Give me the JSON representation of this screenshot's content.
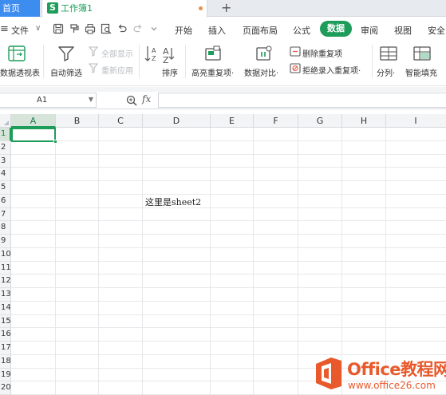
{
  "tabs": {
    "home": "首页",
    "workbook": "工作簿1",
    "workbook_icon": "S",
    "add": "+"
  },
  "menu": {
    "toggle": "≡",
    "file": "文件",
    "file_arrow": "∨",
    "tabs": [
      "开始",
      "插入",
      "页面布局",
      "公式",
      "数据",
      "审阅",
      "视图",
      "安全"
    ],
    "active_tab": "数据"
  },
  "ribbon": {
    "pivot": "数据透视表",
    "autofilter": "自动筛选",
    "show_all": "全部显示",
    "reapply": "重新应用",
    "sort": "排序",
    "highlight_dup": "高亮重复项·",
    "compare": "数据对比·",
    "remove_dup": "删除重复项",
    "reject_dup": "拒绝录入重复项·",
    "split": "分列·",
    "smart_fill": "智能填充"
  },
  "formula_bar": {
    "cell_ref": "A1",
    "fx": "fx",
    "formula": ""
  },
  "sheet": {
    "columns": [
      "A",
      "B",
      "C",
      "D",
      "E",
      "F",
      "G",
      "H",
      "I"
    ],
    "rows": [
      "1",
      "2",
      "3",
      "4",
      "5",
      "6",
      "7",
      "8",
      "9",
      "10",
      "11",
      "12",
      "13",
      "14",
      "15",
      "16",
      "17",
      "18",
      "19",
      "20"
    ],
    "selected_cell": "A1",
    "cell_D6": "这里是sheet2"
  },
  "watermark": {
    "title": "Office教程网",
    "url": "www.office26.com"
  },
  "colors": {
    "accent_green": "#1e9c5a",
    "home_tab_blue": "#3d8cf0",
    "watermark_orange": "#e8592b"
  }
}
